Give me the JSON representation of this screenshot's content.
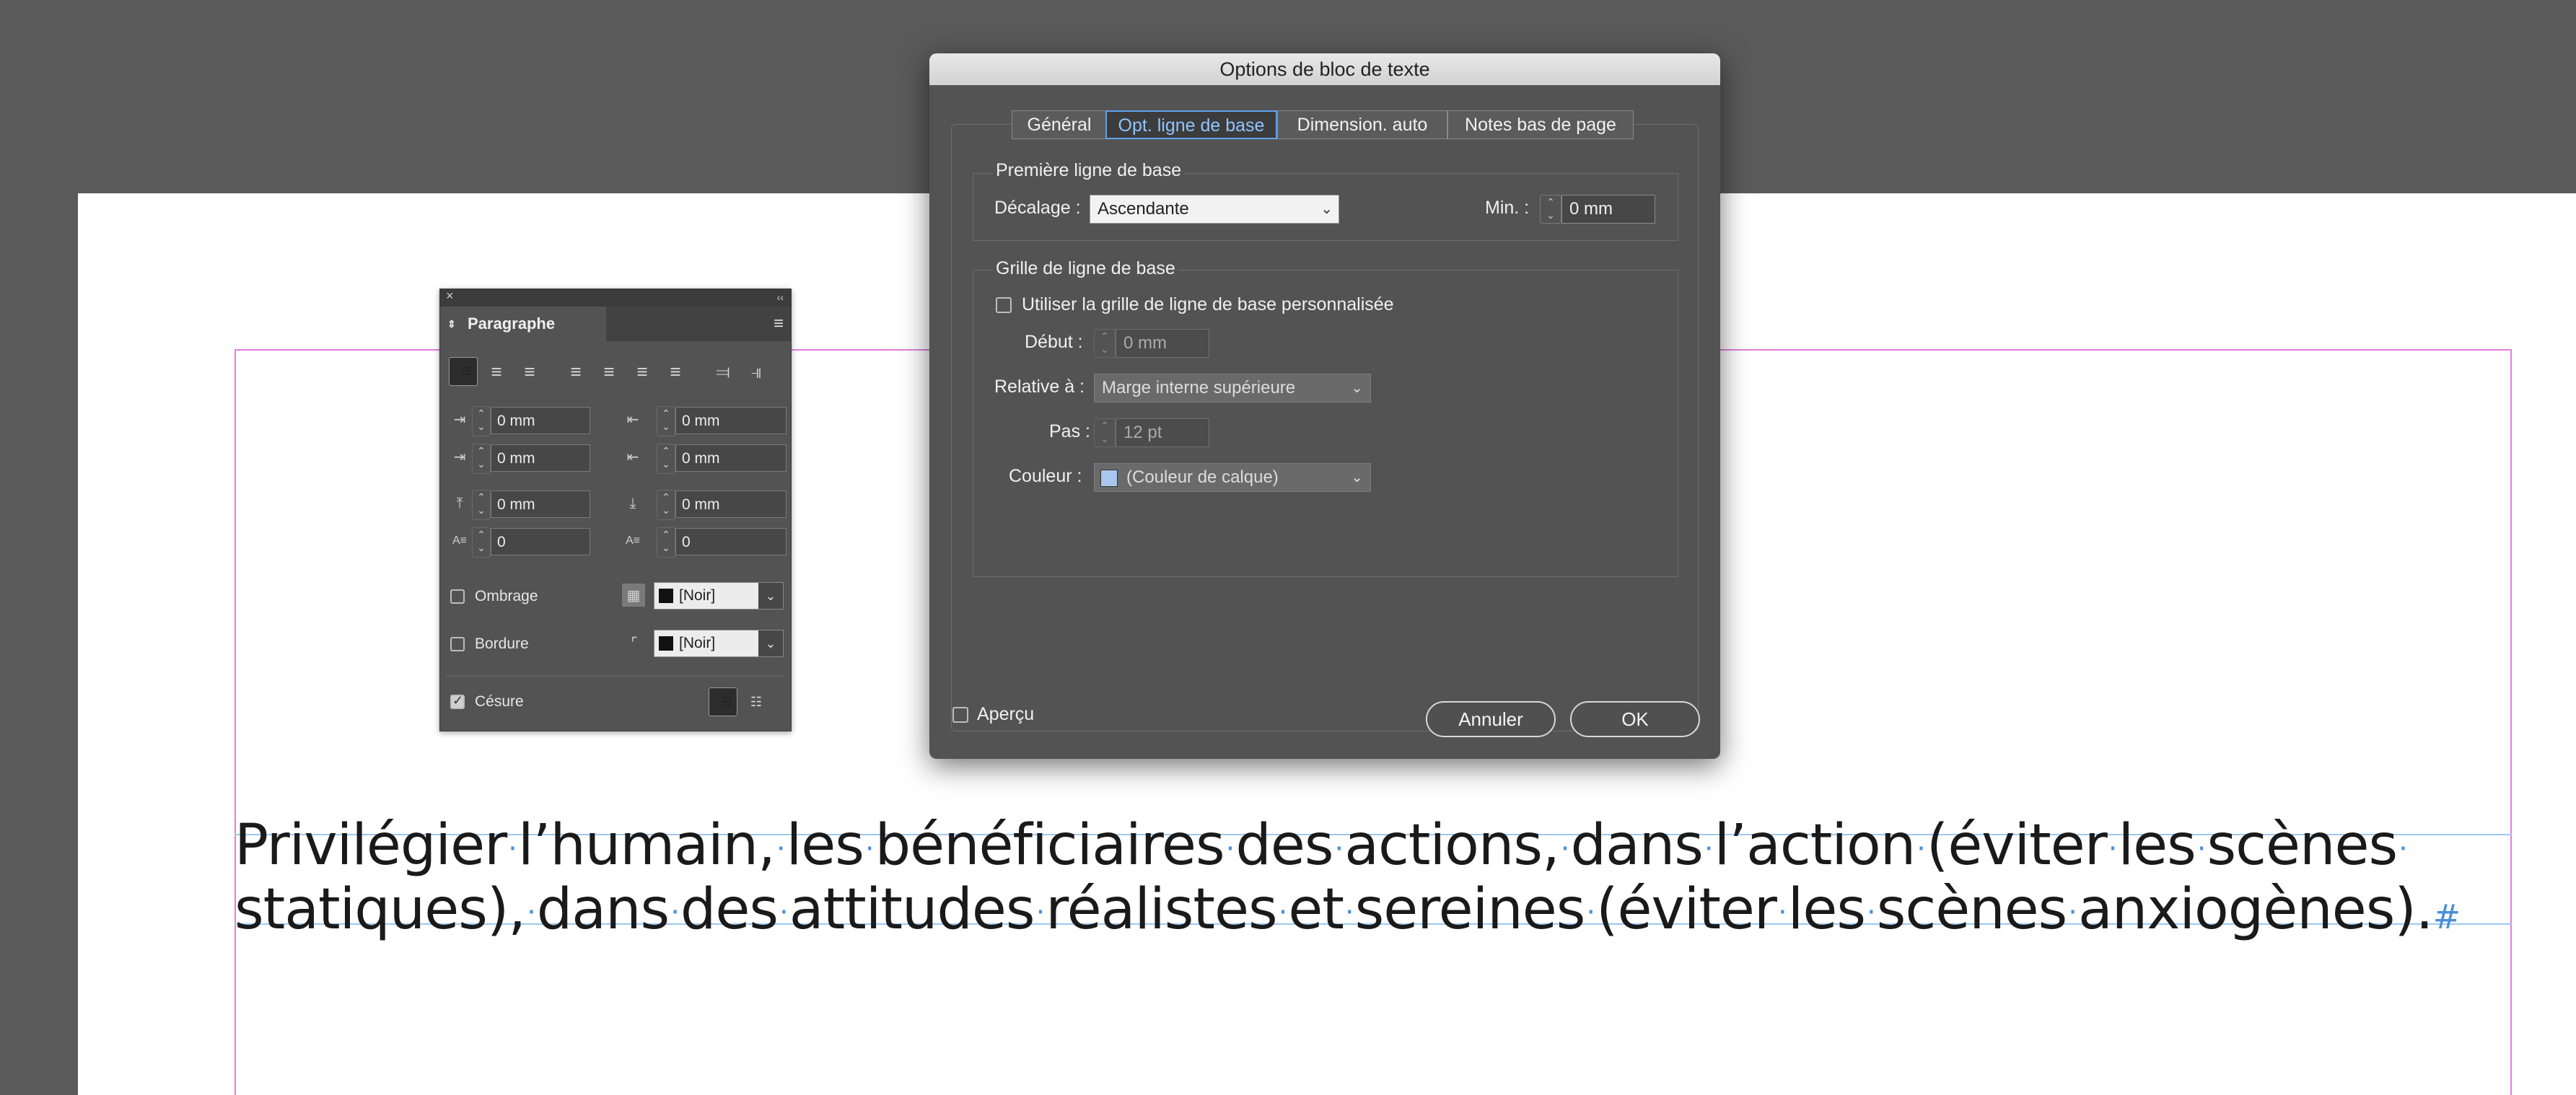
{
  "document": {
    "body_lines": [
      [
        "Privilégier",
        "l’humain,",
        "les",
        "bénéficiaires",
        "des",
        "actions,",
        "dans",
        "l’action",
        "(éviter",
        "les",
        "scènes"
      ],
      [
        "statiques),",
        "dans",
        "des",
        "attitudes",
        "réalistes",
        "et",
        "sereines",
        "(éviter",
        "les",
        "scènes",
        "anxiogènes)."
      ]
    ],
    "end_mark": "#",
    "colors": {
      "margin_guide": "#e07ee0",
      "baseline_guide": "#9ec8ee",
      "hidden_char": "#4a90d9"
    }
  },
  "paragraph_panel": {
    "close_icon": "×",
    "collapse_icon": "‹‹",
    "tab_label": "Paragraphe",
    "menu_icon": "≡",
    "indents": {
      "left": "0 mm",
      "right": "0 mm",
      "first_line": "0 mm",
      "last_line": "0 mm",
      "space_before": "0 mm",
      "space_after": "0 mm",
      "drop_cap_lines": "0",
      "drop_cap_chars": "0"
    },
    "shading_label": "Ombrage",
    "shading_color": "[Noir]",
    "border_label": "Bordure",
    "border_color": "[Noir]",
    "hyphenate_label": "Césure",
    "hyphenate_checked": true
  },
  "dialog": {
    "title": "Options de bloc de texte",
    "tabs": [
      "Général",
      "Opt. ligne de base",
      "Dimension. auto",
      "Notes bas de page"
    ],
    "active_tab": "Opt. ligne de base",
    "first_baseline": {
      "legend": "Première ligne de base",
      "offset_label": "Décalage :",
      "offset_value": "Ascendante",
      "min_label": "Min. :",
      "min_value": "0 mm"
    },
    "baseline_grid": {
      "legend": "Grille de ligne de base",
      "custom_label": "Utiliser la grille de ligne de base personnalisée",
      "custom_checked": false,
      "start_label": "Début :",
      "start_value": "0 mm",
      "relative_label": "Relative à :",
      "relative_value": "Marge interne supérieure",
      "increment_label": "Pas :",
      "increment_value": "12 pt",
      "color_label": "Couleur :",
      "color_value": "(Couleur de calque)",
      "color_swatch": "#a9c6ee"
    },
    "preview_label": "Aperçu",
    "preview_checked": false,
    "cancel_label": "Annuler",
    "ok_label": "OK"
  }
}
